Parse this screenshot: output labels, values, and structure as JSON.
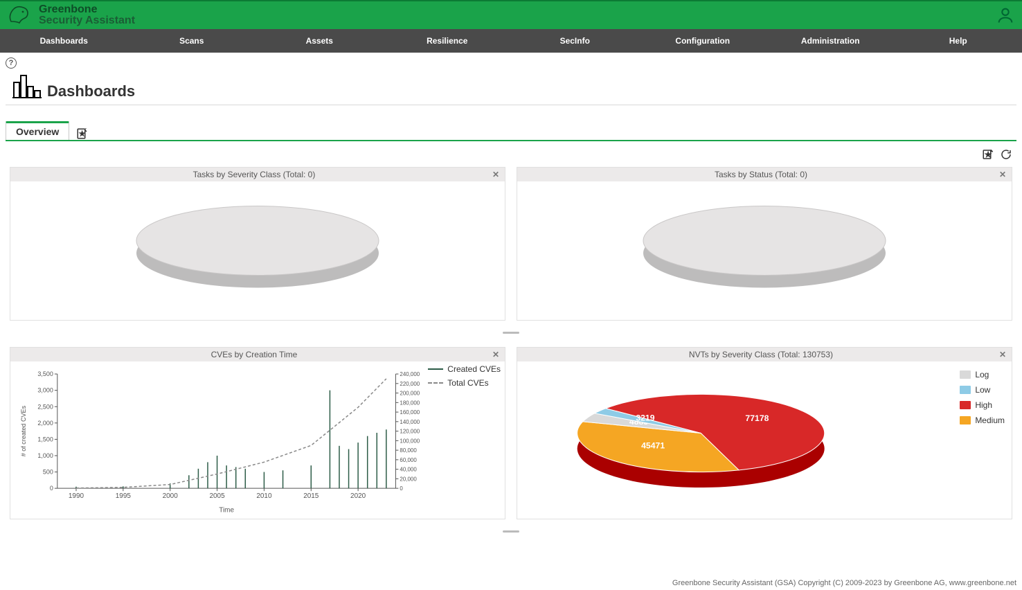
{
  "app": {
    "name_line1": "Greenbone",
    "name_line2": "Security Assistant"
  },
  "nav": [
    "Dashboards",
    "Scans",
    "Assets",
    "Resilience",
    "SecInfo",
    "Configuration",
    "Administration",
    "Help"
  ],
  "page": {
    "title": "Dashboards",
    "tab": "Overview"
  },
  "cards": {
    "tasks_severity": {
      "title": "Tasks by Severity Class (Total: 0)"
    },
    "tasks_status": {
      "title": "Tasks by Status (Total: 0)"
    },
    "cves_time": {
      "title": "CVEs by Creation Time"
    },
    "nvts_severity": {
      "title": "NVTs by Severity Class (Total: 130753)"
    }
  },
  "chart_data": [
    {
      "id": "tasks_severity",
      "type": "pie",
      "title": "Tasks by Severity Class (Total: 0)",
      "values": [],
      "categories": []
    },
    {
      "id": "tasks_status",
      "type": "pie",
      "title": "Tasks by Status (Total: 0)",
      "values": [],
      "categories": []
    },
    {
      "id": "cves_time",
      "type": "line",
      "title": "CVEs by Creation Time",
      "xlabel": "Time",
      "ylabel_left": "# of created CVEs",
      "ylabel_right": "",
      "x_ticks": [
        "1990",
        "1995",
        "2000",
        "2005",
        "2010",
        "2015",
        "2020"
      ],
      "y_ticks_left": [
        "0",
        "500",
        "1,000",
        "1,500",
        "2,000",
        "2,500",
        "3,000",
        "3,500"
      ],
      "y_ticks_right": [
        "0",
        "20,000",
        "40,000",
        "60,000",
        "80,000",
        "100,000",
        "120,000",
        "140,000",
        "160,000",
        "180,000",
        "200,000",
        "220,000",
        "240,000"
      ],
      "series": [
        {
          "name": "Created CVEs",
          "style": "solid",
          "axis": "left",
          "x": [
            1990,
            1995,
            2000,
            2002,
            2003,
            2004,
            2005,
            2006,
            2007,
            2008,
            2010,
            2012,
            2015,
            2017,
            2018,
            2019,
            2020,
            2021,
            2022,
            2023
          ],
          "values": [
            50,
            60,
            150,
            400,
            600,
            800,
            1000,
            700,
            650,
            600,
            500,
            550,
            700,
            3000,
            1300,
            1200,
            1400,
            1600,
            1700,
            1800
          ]
        },
        {
          "name": "Total CVEs",
          "style": "dashed",
          "axis": "right",
          "x": [
            1990,
            1995,
            2000,
            2005,
            2010,
            2015,
            2020,
            2023
          ],
          "values": [
            500,
            2000,
            8000,
            30000,
            55000,
            90000,
            170000,
            230000
          ]
        }
      ],
      "xlim": [
        1988,
        2024
      ],
      "ylim_left": [
        0,
        3500
      ],
      "ylim_right": [
        0,
        240000
      ]
    },
    {
      "id": "nvts_severity",
      "type": "pie",
      "title": "NVTs by Severity Class (Total: 130753)",
      "categories": [
        "Log",
        "Low",
        "High",
        "Medium"
      ],
      "colors": [
        "#d9d9d9",
        "#8ecbe6",
        "#d82828",
        "#f5a623"
      ],
      "values": [
        4885,
        3219,
        77178,
        45471
      ],
      "labels_visible": [
        "45471",
        "4885",
        "3219",
        "77178"
      ]
    }
  ],
  "footer": "Greenbone Security Assistant (GSA) Copyright (C) 2009-2023 by Greenbone AG, www.greenbone.net"
}
